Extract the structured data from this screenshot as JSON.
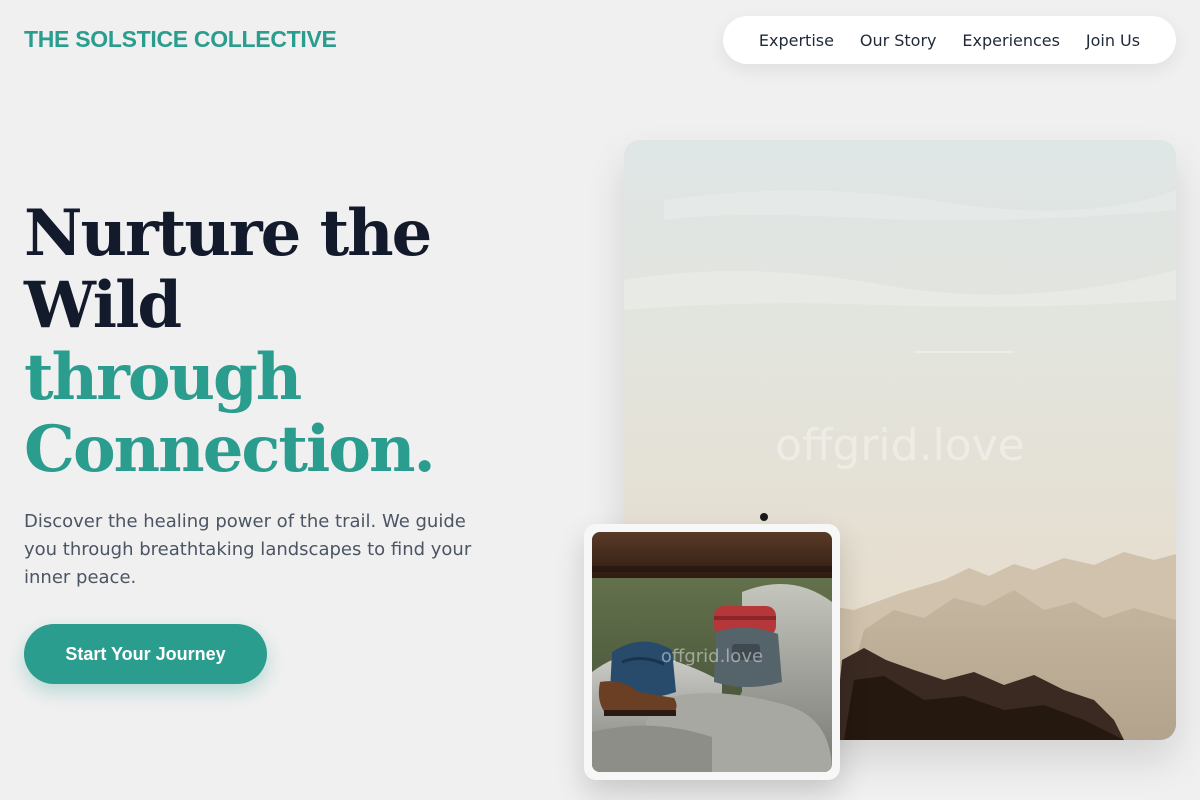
{
  "header": {
    "brand": "THE SOLSTICE COLLECTIVE",
    "nav": [
      {
        "label": "Expertise"
      },
      {
        "label": "Our Story"
      },
      {
        "label": "Experiences"
      },
      {
        "label": "Join Us"
      }
    ]
  },
  "hero": {
    "headline_line1": "Nurture the",
    "headline_line2": "Wild",
    "headline_accent_line1": "through",
    "headline_accent_line2": "Connection.",
    "lead": "Discover the healing power of the trail. We guide you through breathtaking landscapes to find your inner peace.",
    "cta_label": "Start Your Journey"
  },
  "images": {
    "main_watermark": "offgrid.love",
    "inset_watermark": "offgrid.love"
  },
  "colors": {
    "accent": "#2a9d8f",
    "heading": "#121a2c",
    "body_text": "#4b5563",
    "background": "#f0f0f0"
  }
}
